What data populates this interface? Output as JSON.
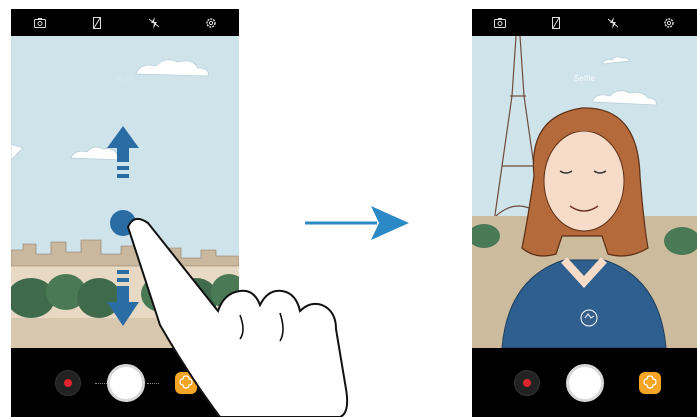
{
  "left_screen": {
    "mode_label": "Auto",
    "top_icons": [
      "switch-camera-icon",
      "aspect-ratio-icon",
      "flash-off-icon",
      "settings-icon"
    ],
    "gesture": "swipe-up-or-down"
  },
  "right_screen": {
    "mode_label": "Selfie",
    "top_icons": [
      "switch-camera-icon",
      "aspect-ratio-icon",
      "flash-off-icon",
      "settings-icon"
    ]
  },
  "colors": {
    "sky": "#cfe3ea",
    "arrow": "#2a6da5",
    "record": "#e0242b",
    "bixby": "#f6a524",
    "bar": "#000000"
  }
}
